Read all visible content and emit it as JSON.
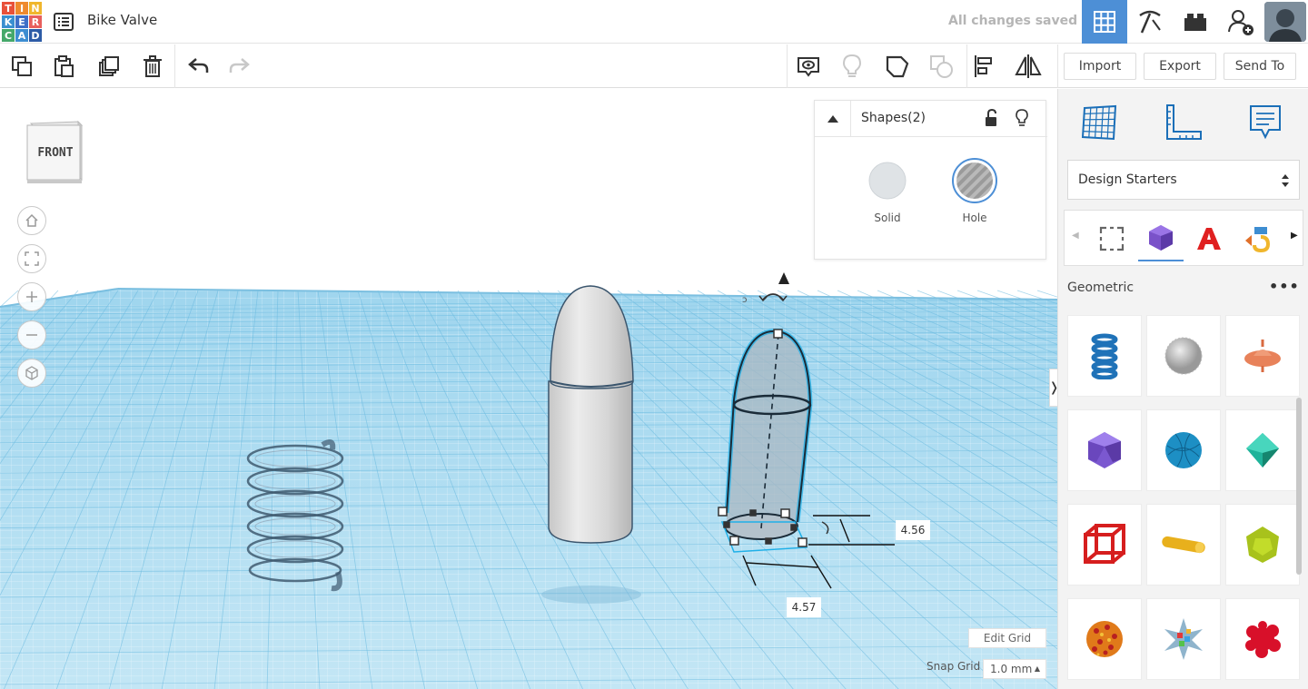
{
  "app": {
    "logo_letters": [
      "T",
      "I",
      "N",
      "K",
      "E",
      "R",
      "C",
      "A",
      "D"
    ],
    "logo_colors": [
      "#e8513a",
      "#ef8a2e",
      "#f0b62c",
      "#3a8fd0",
      "#3f6fc7",
      "#e85f5c",
      "#45a86a",
      "#3d8dd1",
      "#2d5ba6"
    ],
    "document_title": "Bike Valve",
    "save_status": "All changes saved"
  },
  "toolbar": {
    "import_label": "Import",
    "export_label": "Export",
    "send_to_label": "Send To"
  },
  "viewcube": {
    "face_label": "FRONT"
  },
  "inspector": {
    "title": "Shapes(2)",
    "solid_label": "Solid",
    "hole_label": "Hole"
  },
  "dimensions": {
    "height": "4.56",
    "width": "4.57"
  },
  "grid": {
    "edit_label": "Edit Grid",
    "snap_label": "Snap Grid",
    "snap_value": "1.0 mm"
  },
  "right_panel": {
    "library_select": "Design Starters",
    "category": "Geometric",
    "more_label": "•••",
    "shapes": [
      "coil",
      "sphere-noise",
      "spindle",
      "icosahedron",
      "yarn-ball",
      "octahedron",
      "cube-frame",
      "capsule",
      "dodecahedron",
      "voronoi-sphere",
      "star-gem",
      "fractal-blob"
    ]
  },
  "colors": {
    "accent": "#4d8fd6",
    "workplane": "#a8daf0"
  }
}
